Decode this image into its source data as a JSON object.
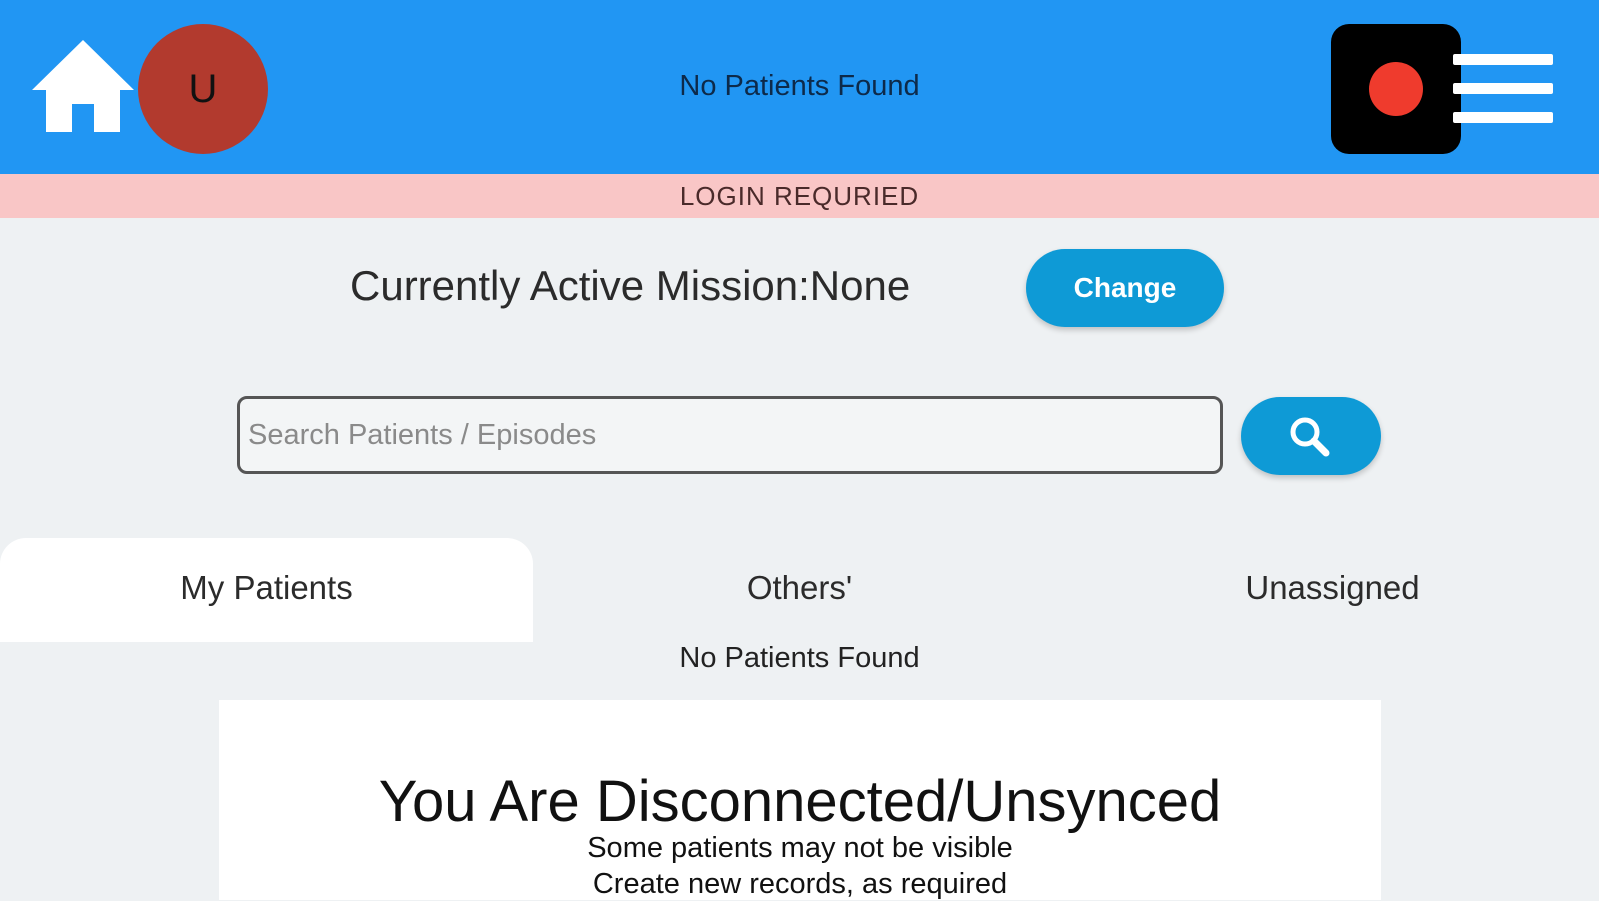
{
  "header": {
    "title": "No Patients Found",
    "avatar_initial": "U",
    "home_icon": "home-icon",
    "record_icon": "record-icon",
    "menu_icon": "hamburger-menu-icon",
    "colors": {
      "bar": "#2196f3",
      "avatar": "#b23a2e",
      "record_dot": "#ef3b2d"
    }
  },
  "banner": {
    "text": "LOGIN REQURIED",
    "color": "#f9c6c6"
  },
  "mission": {
    "label": "Currently Active Mission:None",
    "change_label": "Change"
  },
  "search": {
    "placeholder": "Search Patients / Episodes",
    "value": "",
    "button_icon": "search-icon"
  },
  "tabs": [
    {
      "label": "My Patients",
      "active": true
    },
    {
      "label": "Others'",
      "active": false
    },
    {
      "label": "Unassigned",
      "active": false
    }
  ],
  "list_status": "No Patients Found",
  "notice": {
    "title": "You Are Disconnected/Unsynced",
    "line1": "Some patients may not be visible",
    "line2": "Create new records, as required"
  }
}
